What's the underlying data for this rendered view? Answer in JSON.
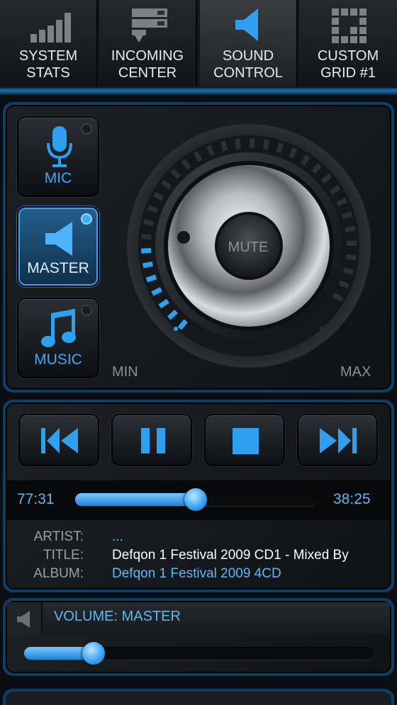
{
  "tabs": [
    {
      "label": "SYSTEM\nSTATS",
      "icon": "bar-chart-icon"
    },
    {
      "label": "INCOMING\nCENTER",
      "icon": "server-icon"
    },
    {
      "label": "SOUND\nCONTROL",
      "icon": "speaker-icon",
      "active": true
    },
    {
      "label": "CUSTOM\nGRID #1",
      "icon": "grid-icon"
    }
  ],
  "sources": {
    "mic": {
      "label": "MIC",
      "icon": "microphone-icon"
    },
    "master": {
      "label": "MASTER",
      "icon": "speaker-icon",
      "active": true
    },
    "music": {
      "label": "MUSIC",
      "icon": "music-note-icon"
    }
  },
  "dial": {
    "mute_label": "MUTE",
    "min_label": "MIN",
    "max_label": "MAX",
    "level": 0.22
  },
  "player": {
    "elapsed": "77:31",
    "remaining": "38:25",
    "progress": 0.5,
    "artist_key": "ARTIST:",
    "title_key": "TITLE:",
    "album_key": "ALBUM:",
    "artist": "...",
    "title": "Defqon 1 Festival 2009 CD1 - Mixed By",
    "album": "Defqon 1 Festival 2009 4CD"
  },
  "volume": {
    "label": "VOLUME: MASTER",
    "level": 0.2
  },
  "colors": {
    "accent": "#3da8f5",
    "active_tab": "#3a3e43",
    "text": "#e8eaec"
  }
}
